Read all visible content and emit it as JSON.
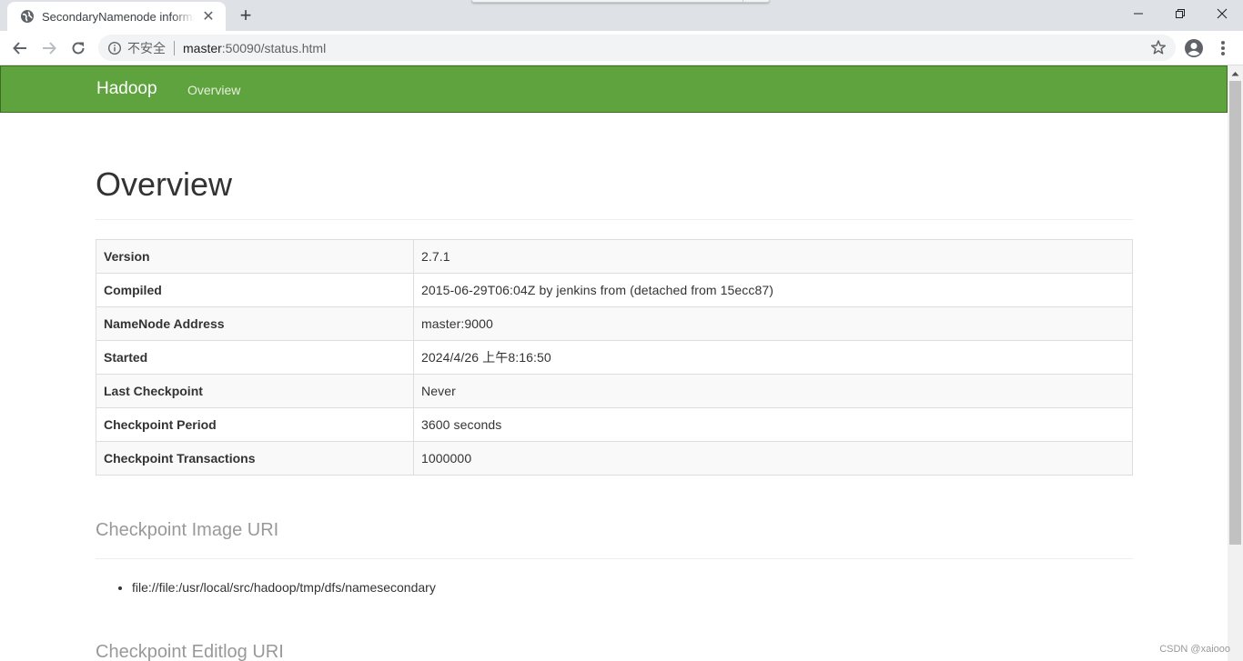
{
  "browser": {
    "tab_title": "SecondaryNamenode information",
    "tab_close": "✕",
    "new_tab": "+",
    "security_label": "不安全",
    "url_host": "master",
    "url_path": ":50090/status.html"
  },
  "navbar": {
    "brand": "Hadoop",
    "link": "Overview",
    "color": "#5fa33e"
  },
  "page": {
    "title": "Overview",
    "info_rows": [
      {
        "key": "Version",
        "value": "2.7.1"
      },
      {
        "key": "Compiled",
        "value": "2015-06-29T06:04Z by jenkins from (detached from 15ecc87)"
      },
      {
        "key": "NameNode Address",
        "value": "master:9000"
      },
      {
        "key": "Started",
        "value": "2024/4/26 上午8:16:50"
      },
      {
        "key": "Last Checkpoint",
        "value": "Never"
      },
      {
        "key": "Checkpoint Period",
        "value": "3600 seconds"
      },
      {
        "key": "Checkpoint Transactions",
        "value": "1000000"
      }
    ],
    "image_uri_heading": "Checkpoint Image URI",
    "image_uris": [
      "file://file:/usr/local/src/hadoop/tmp/dfs/namesecondary"
    ],
    "editlog_uri_heading": "Checkpoint Editlog URI"
  },
  "watermark": "CSDN @xaiooo"
}
